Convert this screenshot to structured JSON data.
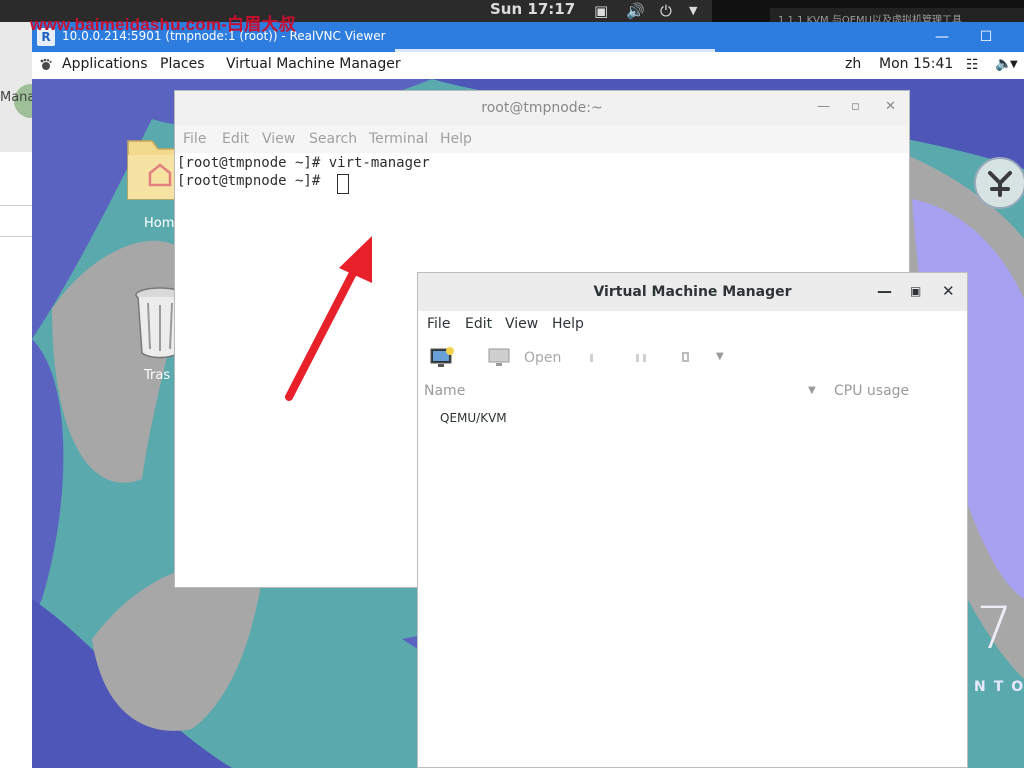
{
  "host": {
    "watermark": "www.baimeidashu.com-白眉大叔",
    "clock": "Sun 17:17",
    "icons": [
      "window-icon",
      "volume-icon",
      "power-icon",
      "chevron-down-icon"
    ],
    "right_strip_text": "1.1.1 KVM 与QEMU以及虚拟机管理工具",
    "left_strip_text": "Mana"
  },
  "vnc": {
    "title": "10.0.0.214:5901 (tmpnode:1 (root)) - RealVNC Viewer",
    "logo": "R"
  },
  "gnome_topbar": {
    "applications": "Applications",
    "places": "Places",
    "active_app": "Virtual Machine Manager",
    "language": "zh",
    "clock": "Mon 15:41"
  },
  "desktop": {
    "home_label": "Hom",
    "trash_label": "Tras",
    "brand_number": "7",
    "brand_text": "NTO"
  },
  "terminal": {
    "title": "root@tmpnode:~",
    "menu": [
      "File",
      "Edit",
      "View",
      "Search",
      "Terminal",
      "Help"
    ],
    "lines": [
      "[root@tmpnode ~]# virt-manager",
      "[root@tmpnode ~]# "
    ]
  },
  "virt_manager": {
    "title": "Virtual Machine Manager",
    "menu": [
      "File",
      "Edit",
      "View",
      "Help"
    ],
    "toolbar": {
      "open_label": "Open"
    },
    "columns": {
      "name": "Name",
      "cpu": "CPU usage"
    },
    "connections": [
      "QEMU/KVM"
    ]
  },
  "colors": {
    "vnc_titlebar": "#2d7de0",
    "desktop_teal": "#5aa9ad",
    "desktop_purple": "#5a63c0",
    "arrow": "#e8202a"
  }
}
